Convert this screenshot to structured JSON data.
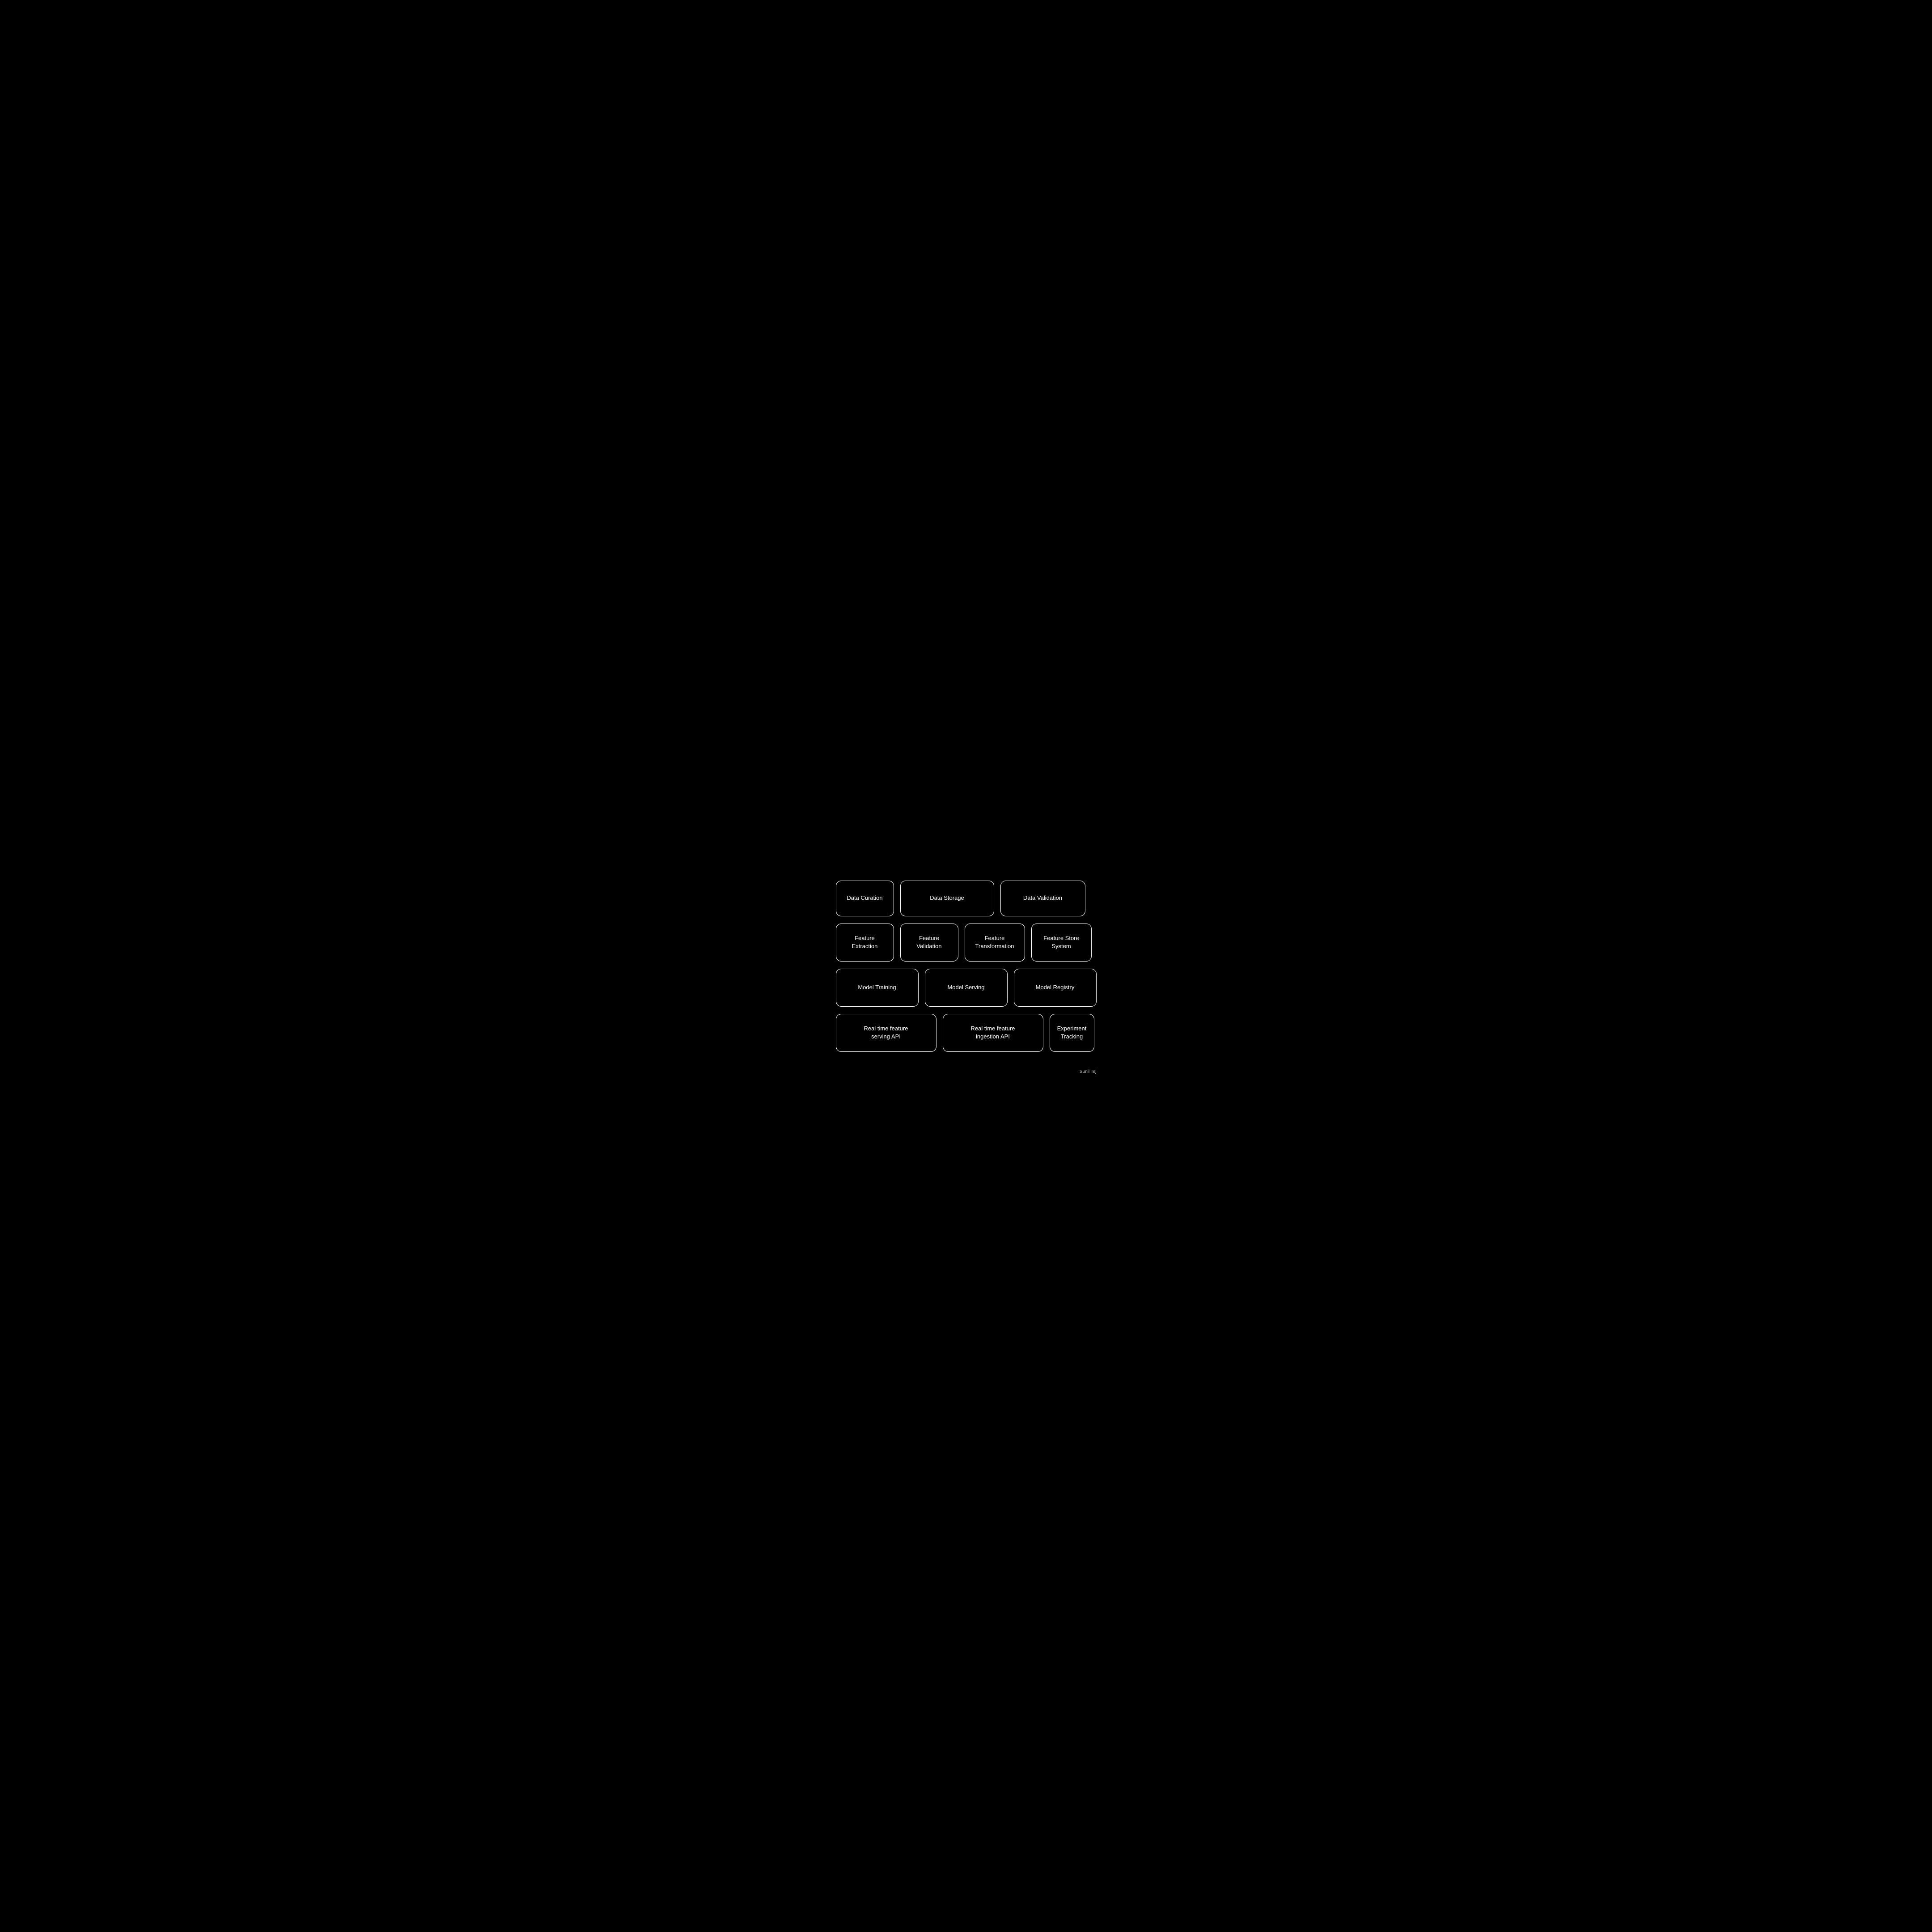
{
  "diagram": {
    "rows": [
      {
        "id": "row1",
        "cards": [
          {
            "id": "data-curation",
            "label": "Data Curation"
          },
          {
            "id": "data-storage",
            "label": "Data Storage"
          },
          {
            "id": "data-validation",
            "label": "Data Validation"
          }
        ]
      },
      {
        "id": "row2",
        "cards": [
          {
            "id": "feature-extraction",
            "label": "Feature\nExtraction"
          },
          {
            "id": "feature-validation",
            "label": "Feature\nValidation"
          },
          {
            "id": "feature-transformation",
            "label": "Feature\nTransformation"
          },
          {
            "id": "feature-store-system",
            "label": "Feature Store\nSystem"
          }
        ]
      },
      {
        "id": "row3",
        "cards": [
          {
            "id": "model-training",
            "label": "Model Training"
          },
          {
            "id": "model-serving",
            "label": "Model Serving"
          },
          {
            "id": "model-registry",
            "label": "Model Registry"
          }
        ]
      },
      {
        "id": "row4",
        "cards": [
          {
            "id": "realtime-serving",
            "label": "Real time feature\nserving API"
          },
          {
            "id": "realtime-ingestion",
            "label": "Real time feature\ningestion API"
          },
          {
            "id": "experiment-tracking",
            "label": "Experiment\nTracking"
          }
        ]
      }
    ],
    "watermark": "Sunil Tej"
  }
}
